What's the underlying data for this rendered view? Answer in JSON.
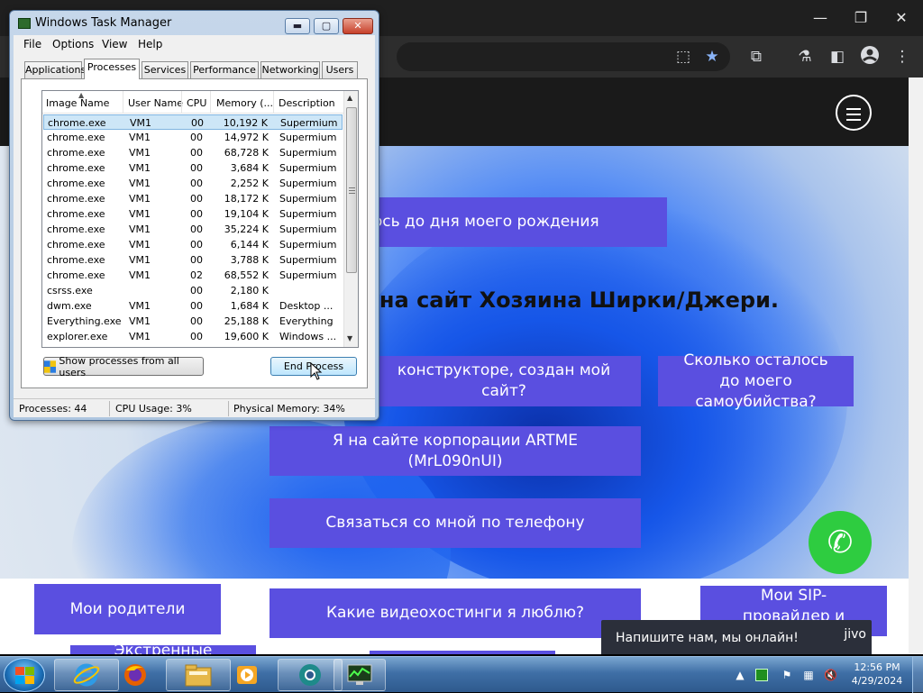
{
  "browser": {
    "window_controls": {
      "minimize": "—",
      "restore": "❐",
      "close": "✕"
    },
    "toolbar_icons": [
      "translate-icon",
      "bookmark-star-icon",
      "extensions-icon",
      "labs-icon",
      "side-panel-icon",
      "profile-icon",
      "menu-icon"
    ],
    "accent": "#8ab4f8"
  },
  "website": {
    "heading": "л на сайт Хозяина Ширки/Джери.",
    "buttons": {
      "birthday": "лось до дня моего рождения",
      "constructor": "конструкторе, создан мой сайт?",
      "suicide": "Сколько осталось до моего самоубийства?",
      "artme": "Я на сайте корпорации ARTME (MrL090nUI)",
      "phone": "Связаться со мной по телефону",
      "parents": "Мои родители",
      "video": "Какие видеохостинги я люблю?",
      "sip": "Мои SIP-провайдер и",
      "emergency": "Экстренные"
    },
    "chat_widget": {
      "text": "Напишите нам, мы онлайн!",
      "logo": "jivo"
    },
    "button_color": "#5a4fe0",
    "phone_color": "#2ecc40"
  },
  "task_manager": {
    "title": "Windows Task Manager",
    "controls": {
      "minimize": "▬",
      "maximize": "▢",
      "close": "✕"
    },
    "menu": [
      "File",
      "Options",
      "View",
      "Help"
    ],
    "tabs": [
      "Applications",
      "Processes",
      "Services",
      "Performance",
      "Networking",
      "Users"
    ],
    "active_tab": "Processes",
    "columns": [
      "Image Name",
      "User Name",
      "CPU",
      "Memory (...",
      "Description"
    ],
    "rows": [
      {
        "name": "chrome.exe",
        "user": "VM1",
        "cpu": "00",
        "mem": "10,192 K",
        "desc": "Supermium"
      },
      {
        "name": "chrome.exe",
        "user": "VM1",
        "cpu": "00",
        "mem": "14,972 K",
        "desc": "Supermium"
      },
      {
        "name": "chrome.exe",
        "user": "VM1",
        "cpu": "00",
        "mem": "68,728 K",
        "desc": "Supermium"
      },
      {
        "name": "chrome.exe",
        "user": "VM1",
        "cpu": "00",
        "mem": "3,684 K",
        "desc": "Supermium"
      },
      {
        "name": "chrome.exe",
        "user": "VM1",
        "cpu": "00",
        "mem": "2,252 K",
        "desc": "Supermium"
      },
      {
        "name": "chrome.exe",
        "user": "VM1",
        "cpu": "00",
        "mem": "18,172 K",
        "desc": "Supermium"
      },
      {
        "name": "chrome.exe",
        "user": "VM1",
        "cpu": "00",
        "mem": "19,104 K",
        "desc": "Supermium"
      },
      {
        "name": "chrome.exe",
        "user": "VM1",
        "cpu": "00",
        "mem": "35,224 K",
        "desc": "Supermium"
      },
      {
        "name": "chrome.exe",
        "user": "VM1",
        "cpu": "00",
        "mem": "6,144 K",
        "desc": "Supermium"
      },
      {
        "name": "chrome.exe",
        "user": "VM1",
        "cpu": "00",
        "mem": "3,788 K",
        "desc": "Supermium"
      },
      {
        "name": "chrome.exe",
        "user": "VM1",
        "cpu": "02",
        "mem": "68,552 K",
        "desc": "Supermium"
      },
      {
        "name": "csrss.exe",
        "user": "",
        "cpu": "00",
        "mem": "2,180 K",
        "desc": ""
      },
      {
        "name": "dwm.exe",
        "user": "VM1",
        "cpu": "00",
        "mem": "1,684 K",
        "desc": "Desktop ..."
      },
      {
        "name": "Everything.exe",
        "user": "VM1",
        "cpu": "00",
        "mem": "25,188 K",
        "desc": "Everything"
      },
      {
        "name": "explorer.exe",
        "user": "VM1",
        "cpu": "00",
        "mem": "19,600 K",
        "desc": "Windows ..."
      }
    ],
    "selected_row": 0,
    "show_all_button": "Show processes from all users",
    "end_process_button": "End Process",
    "status": {
      "processes": "Processes: 44",
      "cpu": "CPU Usage: 3%",
      "memory": "Physical Memory: 34%"
    }
  },
  "taskbar": {
    "apps": [
      "internet-explorer-icon",
      "firefox-icon",
      "file-explorer-icon",
      "media-player-icon",
      "chrome-app-icon",
      "task-manager-icon"
    ],
    "tray_chevron": "▲",
    "clock": {
      "time": "12:56 PM",
      "date": "4/29/2024"
    }
  }
}
